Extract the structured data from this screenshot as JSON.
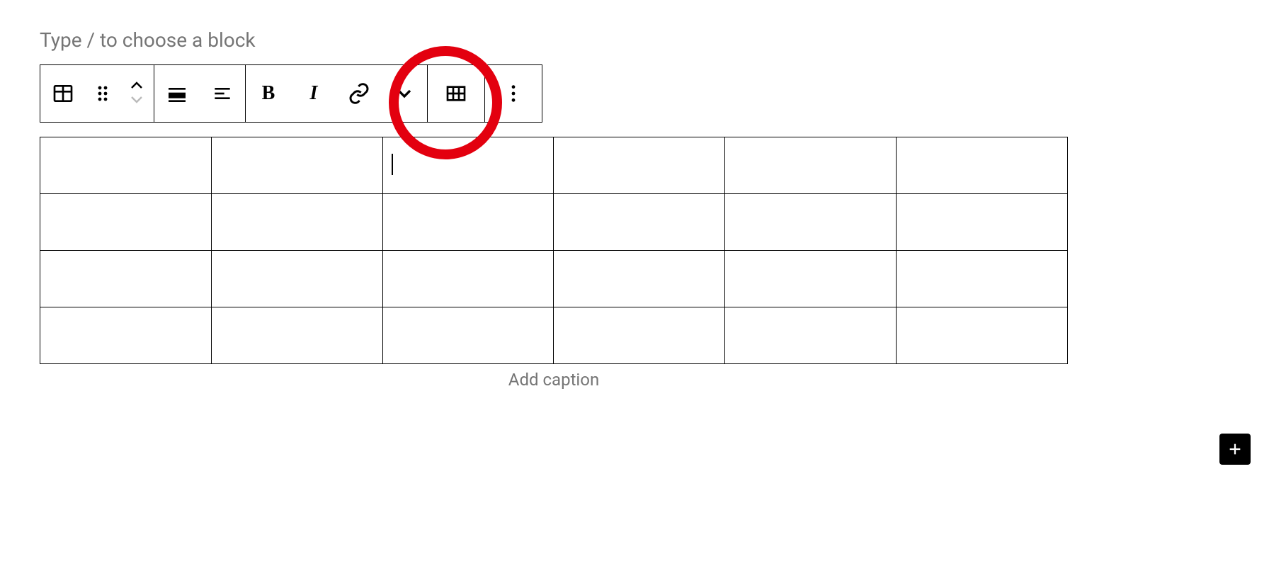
{
  "editor": {
    "placeholder": "Type / to choose a block",
    "caption_placeholder": "Add caption"
  },
  "toolbar": {
    "block_type": "table",
    "drag": "drag",
    "move_up": "up",
    "move_down": "down",
    "align": "align",
    "justify": "justify",
    "bold_label": "B",
    "italic_label": "I",
    "link": "link",
    "more_rich": "more",
    "edit_table": "edit-table",
    "options": "options"
  },
  "table": {
    "rows": 4,
    "cols": 6,
    "active_cell": {
      "row": 0,
      "col": 2
    },
    "cells": [
      [
        "",
        "",
        "",
        "",
        "",
        ""
      ],
      [
        "",
        "",
        "",
        "",
        "",
        ""
      ],
      [
        "",
        "",
        "",
        "",
        "",
        ""
      ],
      [
        "",
        "",
        "",
        "",
        "",
        ""
      ]
    ]
  },
  "annotation": {
    "highlight": "link-and-dropdown"
  }
}
